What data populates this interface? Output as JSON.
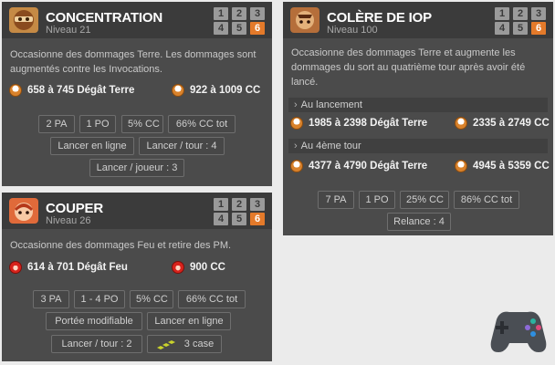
{
  "spells": [
    {
      "name": "CONCENTRATION",
      "level": "Niveau 21",
      "levels": [
        "1",
        "2",
        "3",
        "4",
        "5",
        "6"
      ],
      "description": "Occasionne des dommages Terre. Les dommages sont augmentés contre les Invocations.",
      "damage": "658 à 745 Dégât Terre",
      "crit": "922 à 1009 CC",
      "tags": [
        "2 PA",
        "1 PO",
        "5% CC",
        "66% CC tot",
        "Lancer en ligne",
        "Lancer / tour : 4",
        "Lancer / joueur : 3"
      ]
    },
    {
      "name": "COUPER",
      "level": "Niveau 26",
      "levels": [
        "1",
        "2",
        "3",
        "4",
        "5",
        "6"
      ],
      "description": "Occasionne des dommages Feu et retire des PM.",
      "damage": "614 à 701 Dégât Feu",
      "crit": "900 CC",
      "tags": [
        "3 PA",
        "1 - 4 PO",
        "5% CC",
        "66% CC tot",
        "Portée modifiable",
        "Lancer en ligne",
        "Lancer / tour : 2",
        "3 case"
      ]
    },
    {
      "name": "COLÈRE DE IOP",
      "level": "Niveau 100",
      "levels": [
        "1",
        "2",
        "3",
        "4",
        "5",
        "6"
      ],
      "description": "Occasionne des dommages Terre et augmente les dommages du sort au quatrième tour après avoir été lancé.",
      "section1": "Au lancement",
      "damage1": "1985 à 2398 Dégât Terre",
      "crit1": "2335 à 2749 CC",
      "section2": "Au 4ème tour",
      "damage2": "4377 à 4790 Dégât Terre",
      "crit2": "4945 à 5359 CC",
      "tags": [
        "7 PA",
        "1 PO",
        "25% CC",
        "86% CC tot",
        "Relance : 4"
      ]
    }
  ],
  "icons": {
    "earth": "earth-element-icon",
    "fire": "fire-element-icon",
    "area": "line-area-icon",
    "gamepad": "gamepad-watermark-icon"
  },
  "colors": {
    "active_level": "#e47a2a",
    "card_bg": "#4b4b4b",
    "header_bg": "#3b3b3b"
  }
}
